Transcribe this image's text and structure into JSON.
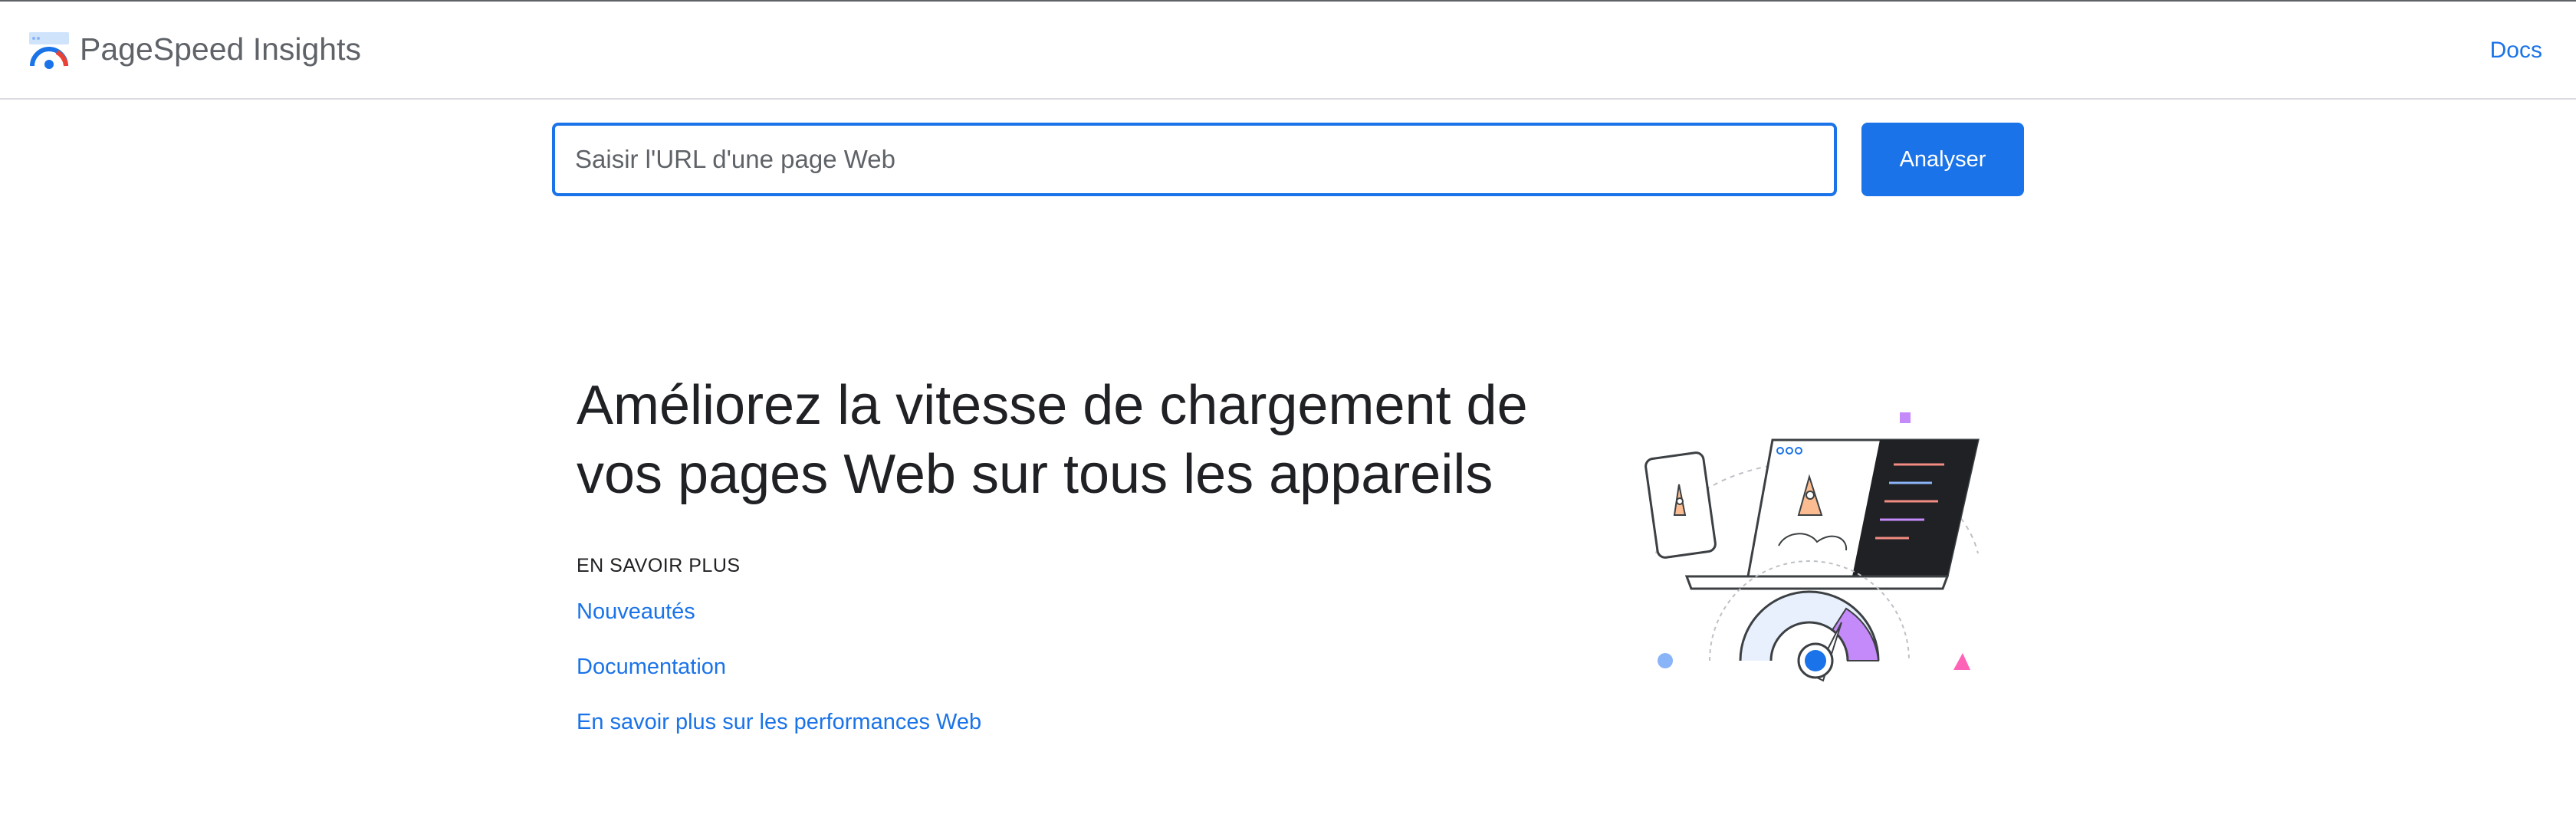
{
  "header": {
    "brand": "PageSpeed Insights",
    "docs_label": "Docs"
  },
  "search": {
    "placeholder": "Saisir l'URL d'une page Web",
    "value": "",
    "button_label": "Analyser"
  },
  "hero": {
    "title": "Améliorez la vitesse de chargement de vos pages Web sur tous les appareils"
  },
  "learn_more": {
    "heading": "EN SAVOIR PLUS",
    "links": [
      {
        "label": "Nouveautés"
      },
      {
        "label": "Documentation"
      },
      {
        "label": "En savoir plus sur les performances Web"
      }
    ]
  },
  "colors": {
    "accent": "#1a73e8",
    "text": "#202124",
    "muted": "#5f6368",
    "divider": "#dadce0"
  },
  "icons": {
    "logo": "pagespeed-logo-icon",
    "illustration": "speed-devices-illustration"
  }
}
